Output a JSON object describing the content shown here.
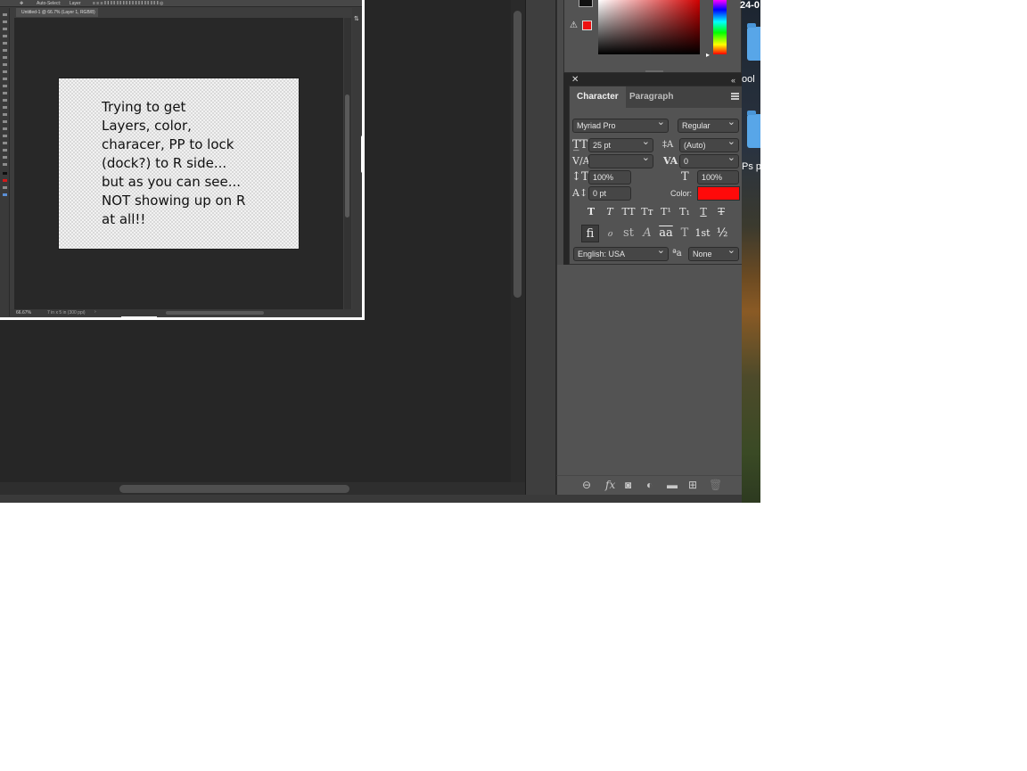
{
  "document": {
    "tab_title": "Untitled-1 @ 66.7% (Layer 1, RGB/8)",
    "zoom": "66.67%",
    "doc_info": "7 in x 5 in (300 ppi)",
    "options_autoselect": "Auto-Select:",
    "options_layer": "Layer",
    "text_lines": [
      "Trying to get",
      "Layers, color,",
      "characer, PP to lock",
      "(dock?) to R side...",
      "but as  you can see...",
      "NOT showing up on R",
      "at all!!"
    ]
  },
  "desktop": {
    "date_fragment": "24-0",
    "label_1": "ool",
    "label_2": "Ps p"
  },
  "character_panel": {
    "tabs": [
      "Character",
      "Paragraph"
    ],
    "font_family": "Myriad Pro",
    "font_style": "Regular",
    "font_size": "25 pt",
    "leading": "(Auto)",
    "kerning": "",
    "tracking": "0",
    "vertical_scale": "100%",
    "horizontal_scale": "100%",
    "baseline_shift": "0 pt",
    "color_label": "Color:",
    "text_color": "#ff0a0a",
    "language": "English: USA",
    "antialias": "None",
    "style_buttons": [
      "T",
      "T",
      "TT",
      "Tт",
      "T¹",
      "T₁",
      "T",
      "T"
    ],
    "opentype_buttons": [
      "fi",
      "ℴ",
      "st",
      "A",
      "aa",
      "T",
      "1st",
      "½"
    ]
  },
  "color_panel": {
    "gamut_warning_color": "#ee1111",
    "foreground": "#101010"
  }
}
